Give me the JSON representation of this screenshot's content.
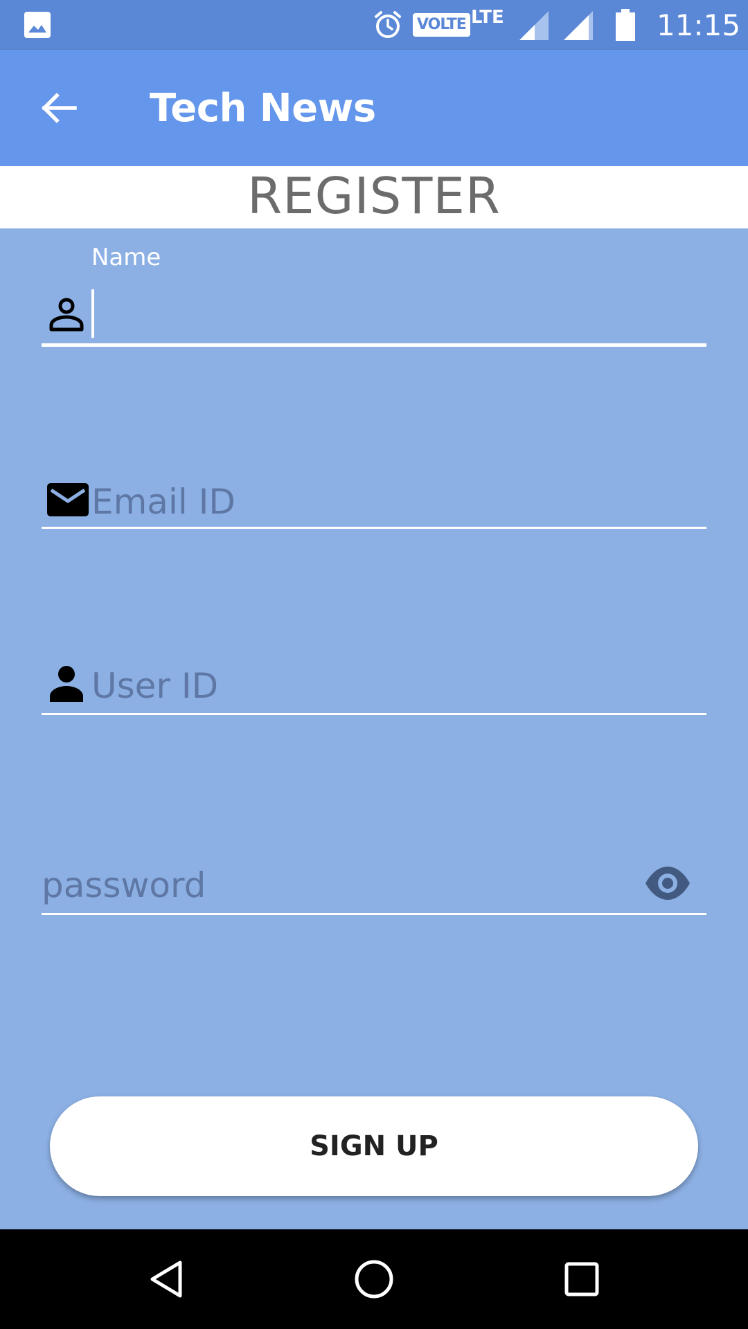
{
  "status_bar": {
    "time": "11:15",
    "volte_label": "VOLTE",
    "network_label": "LTE",
    "icons": [
      "gallery-icon",
      "alarm-icon",
      "signal-icon",
      "signal-icon",
      "battery-icon"
    ]
  },
  "app_bar": {
    "title": "Tech News",
    "back_icon": "arrow-back-icon"
  },
  "register": {
    "heading": "REGISTER"
  },
  "form": {
    "name": {
      "label": "Name",
      "value": "",
      "icon": "person-outline-icon"
    },
    "email": {
      "placeholder": "Email ID",
      "value": "",
      "icon": "mail-icon"
    },
    "user_id": {
      "placeholder": "User ID",
      "value": "",
      "icon": "person-icon"
    },
    "password": {
      "placeholder": "password",
      "value": "",
      "icon": "eye-icon"
    }
  },
  "signup_button": {
    "label": "SIGN UP"
  },
  "nav_bar": {
    "icons": [
      "nav-back-icon",
      "nav-home-icon",
      "nav-recents-icon"
    ]
  },
  "colors": {
    "status_bar": "#5b88d6",
    "app_bar": "#6496eb",
    "form_background": "#8cb0e4",
    "heading_text": "#6c6c6c",
    "placeholder_text": "#5e77a4"
  }
}
